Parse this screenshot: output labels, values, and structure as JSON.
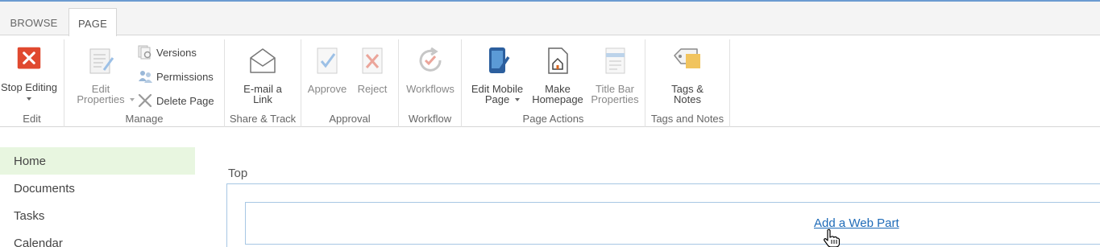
{
  "tabs": [
    {
      "label": "BROWSE",
      "active": false
    },
    {
      "label": "PAGE",
      "active": true
    }
  ],
  "ribbon": {
    "edit": {
      "label": "Edit",
      "stop_editing": "Stop Editing"
    },
    "manage": {
      "label": "Manage",
      "edit_properties": "Edit\nProperties",
      "versions": "Versions",
      "permissions": "Permissions",
      "delete_page": "Delete Page"
    },
    "share": {
      "label": "Share & Track",
      "email_link": "E-mail a\nLink"
    },
    "approval": {
      "label": "Approval",
      "approve": "Approve",
      "reject": "Reject"
    },
    "workflow": {
      "label": "Workflow",
      "workflows": "Workflows"
    },
    "page_actions": {
      "label": "Page Actions",
      "edit_mobile": "Edit Mobile\nPage",
      "make_homepage": "Make\nHomepage",
      "title_bar": "Title Bar\nProperties"
    },
    "tags": {
      "label": "Tags and Notes",
      "tags_notes": "Tags &\nNotes"
    }
  },
  "nav": {
    "items": [
      {
        "label": "Home",
        "active": true
      },
      {
        "label": "Documents",
        "active": false
      },
      {
        "label": "Tasks",
        "active": false
      },
      {
        "label": "Calendar",
        "active": false
      }
    ]
  },
  "content": {
    "zone_label": "Top",
    "add_web_part": "Add a Web Part"
  },
  "colors": {
    "accent": "#6b9bd1",
    "link": "#1e6bb8",
    "stop_icon": "#e0492f",
    "nav_active": "#e8f6e0"
  },
  "icons": [
    "close-icon",
    "edit-properties-icon",
    "versions-icon",
    "permissions-icon",
    "delete-icon",
    "email-icon",
    "approve-icon",
    "reject-icon",
    "workflow-icon",
    "mobile-icon",
    "homepage-icon",
    "title-bar-icon",
    "tag-icon",
    "hand-cursor-icon"
  ]
}
